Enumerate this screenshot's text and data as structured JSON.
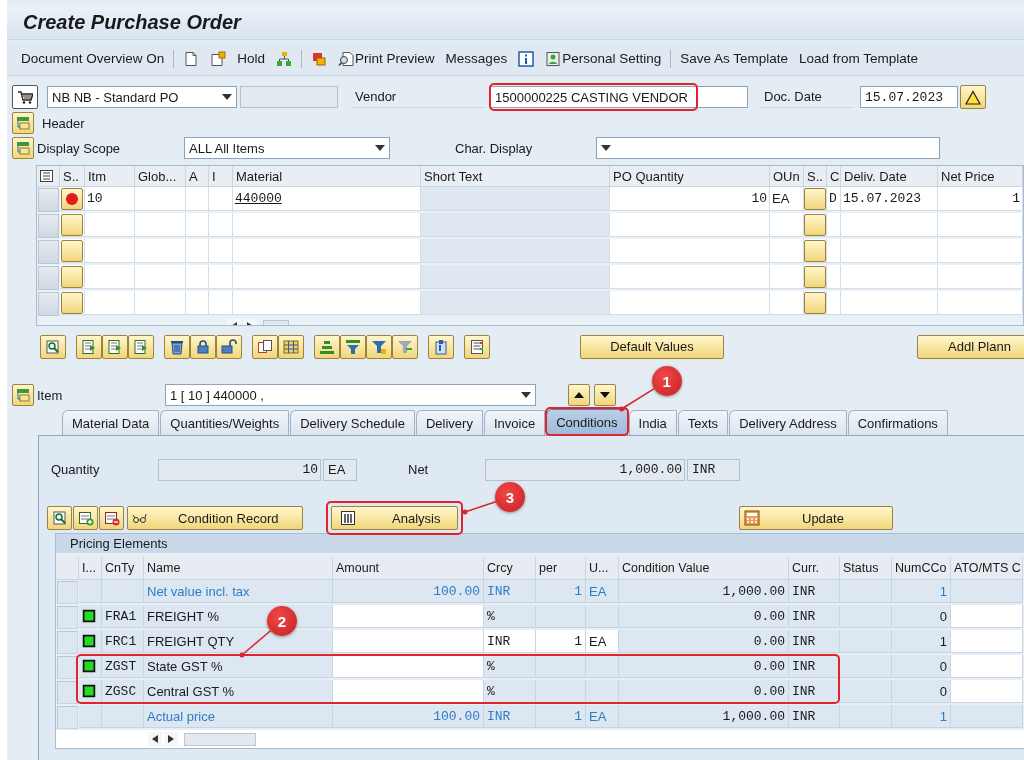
{
  "window": {
    "title": "Create Purchase Order"
  },
  "toolbar": [
    {
      "kind": "text",
      "label": "Document Overview On"
    },
    {
      "kind": "separator"
    },
    {
      "kind": "icon"
    },
    {
      "kind": "icon"
    },
    {
      "kind": "text",
      "label": "Hold"
    },
    {
      "kind": "icon"
    },
    {
      "kind": "separator"
    },
    {
      "kind": "icon"
    },
    {
      "kind": "icon_text",
      "label": "Print Preview"
    },
    {
      "kind": "text",
      "label": "Messages"
    },
    {
      "kind": "icon"
    },
    {
      "kind": "icon_text",
      "label": "Personal Setting"
    },
    {
      "kind": "separator"
    },
    {
      "kind": "text",
      "label": "Save As Template"
    },
    {
      "kind": "text",
      "label": "Load from Template"
    }
  ],
  "header": {
    "doc_type": "NB NB - Standard PO",
    "vendor_label": "Vendor",
    "vendor": "1500000225 CASTING VENDOR",
    "vendor_highlighted": true,
    "doc_date_label": "Doc. Date",
    "doc_date": "15.07.2023",
    "header_label": "Header",
    "display_scope_label": "Display Scope",
    "display_scope": "ALL All Items",
    "char_display_label": "Char. Display"
  },
  "items_table": {
    "columns": [
      "S..",
      "Itm",
      "Glob...",
      "A",
      "I",
      "Material",
      "Short Text",
      "PO Quantity",
      "OUn",
      "S..",
      "C",
      "Deliv. Date",
      "Net Price"
    ],
    "rows": [
      {
        "color": "#e31b1b",
        "item": "10",
        "material": "440000",
        "po_quantity": "10",
        "unit": "EA",
        "category": "D",
        "delivery_date": "15.07.2023",
        "net_price": "1"
      },
      {},
      {},
      {},
      {}
    ]
  },
  "item_actions": [
    "Default Values",
    "Addl Plann"
  ],
  "item_selector": {
    "label": "Item",
    "value": "1 [ 10 ] 440000 ,"
  },
  "tabs": [
    {
      "label": "Material Data",
      "selected": false,
      "highlighted": false
    },
    {
      "label": "Quantities/Weights",
      "selected": false,
      "highlighted": false
    },
    {
      "label": "Delivery Schedule",
      "selected": false,
      "highlighted": false
    },
    {
      "label": "Delivery",
      "selected": false,
      "highlighted": false
    },
    {
      "label": "Invoice",
      "selected": false,
      "highlighted": false
    },
    {
      "label": "Conditions",
      "selected": true,
      "highlighted": true,
      "callout": "1"
    },
    {
      "label": "India",
      "selected": false,
      "highlighted": false
    },
    {
      "label": "Texts",
      "selected": false,
      "highlighted": false
    },
    {
      "label": "Delivery Address",
      "selected": false,
      "highlighted": false
    },
    {
      "label": "Confirmations",
      "selected": false,
      "highlighted": false
    }
  ],
  "conditions": {
    "quantity_label": "Quantity",
    "quantity": "10",
    "quantity_unit": "EA",
    "net_label": "Net",
    "net": "1,000.00",
    "net_currency": "INR",
    "buttons": [
      {
        "label": "Condition Record",
        "highlighted": false
      },
      {
        "label": "Analysis",
        "highlighted": true,
        "callout": "3"
      },
      {
        "label": "Update",
        "highlighted": false
      }
    ],
    "pricing_title": "Pricing Elements",
    "columns": [
      "I...",
      "CnTy",
      "Name",
      "Amount",
      "Crcy",
      "per",
      "U...",
      "Condition Value",
      "Curr.",
      "Status",
      "NumCCo",
      "ATO/MTS C"
    ],
    "rows": [
      {
        "kind": "total",
        "name": "Net value incl. tax",
        "amount": "100.00",
        "currency": "INR",
        "per": "1",
        "unit": "EA",
        "condition_value": "1,000.00",
        "curr": "INR",
        "num_cco": "1",
        "highlighted": false
      },
      {
        "kind": "condition",
        "color": "#22dd22",
        "cond_type": "FRA1",
        "name": "FREIGHT %",
        "currency": "%",
        "condition_value": "0.00",
        "curr": "INR",
        "num_cco": "0",
        "unit_editable": false,
        "highlighted": false
      },
      {
        "kind": "condition",
        "color": "#22dd22",
        "cond_type": "FRC1",
        "name": "FREIGHT QTY",
        "currency": "INR",
        "per": "1",
        "unit": "EA",
        "condition_value": "0.00",
        "curr": "INR",
        "num_cco": "1",
        "unit_editable": true,
        "highlighted": false
      },
      {
        "kind": "condition",
        "color": "#22dd22",
        "cond_type": "ZGST",
        "name": "State GST %",
        "currency": "%",
        "condition_value": "0.00",
        "curr": "INR",
        "num_cco": "0",
        "unit_editable": false,
        "highlighted": true,
        "callout": "2"
      },
      {
        "kind": "condition",
        "color": "#22dd22",
        "cond_type": "ZGSC",
        "name": "Central GST %",
        "currency": "%",
        "condition_value": "0.00",
        "curr": "INR",
        "num_cco": "0",
        "unit_editable": false,
        "highlighted": true
      },
      {
        "kind": "total",
        "name": "Actual price",
        "amount": "100.00",
        "currency": "INR",
        "per": "1",
        "unit": "EA",
        "condition_value": "1,000.00",
        "curr": "INR",
        "num_cco": "1",
        "highlighted": false
      }
    ]
  }
}
